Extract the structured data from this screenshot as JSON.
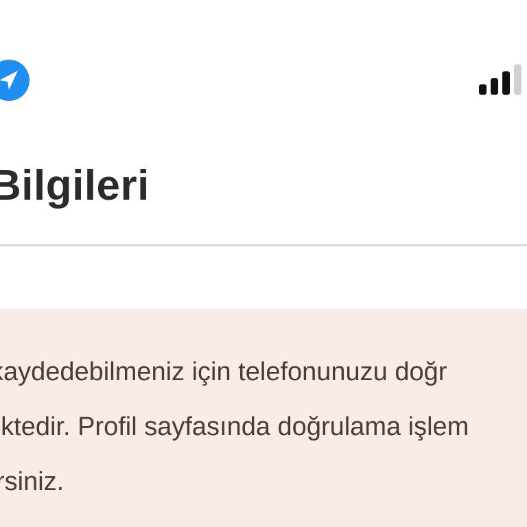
{
  "status_bar": {
    "location_icon": "location-arrow-icon",
    "signal_icon": "cellular-signal-icon",
    "accent_color": "#1e8ef3"
  },
  "header": {
    "title": "Bilgileri"
  },
  "notice": {
    "background_color": "#f9ebe7",
    "lines": [
      "kaydedebilmeniz için telefonunuzu doğr",
      "ektedir. Profil sayfasında doğrulama işlem",
      "rsiniz."
    ]
  }
}
